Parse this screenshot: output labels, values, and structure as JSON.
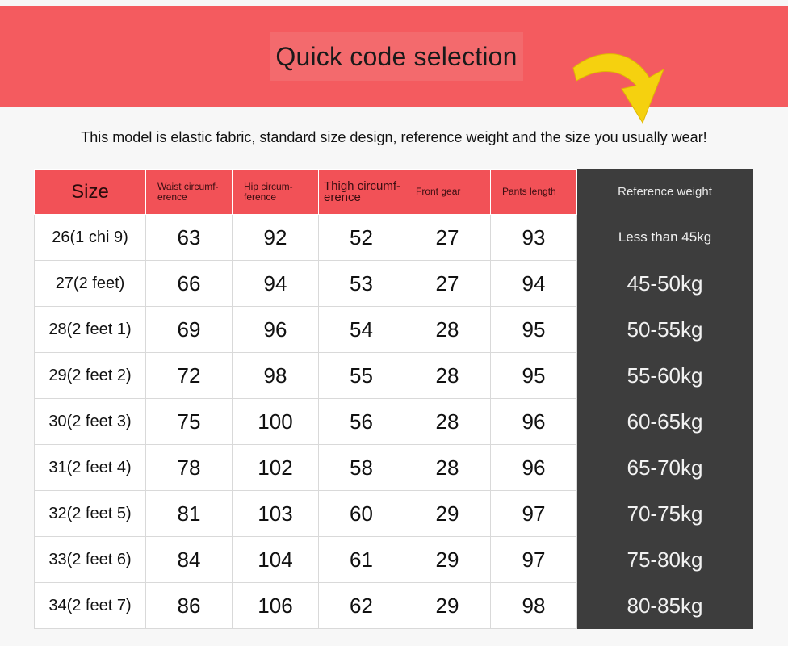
{
  "banner": {
    "title": "Quick code selection"
  },
  "subtitle": "This model is elastic fabric, standard size design, reference weight and the size you usually wear!",
  "table": {
    "headers": [
      "Size",
      "Waist circumf-erence",
      "Hip circum-ference",
      "Thigh circumf-erence",
      "Front gear",
      "Pants length",
      "Reference weight"
    ],
    "rows": [
      [
        "26(1 chi 9)",
        "63",
        "92",
        "52",
        "27",
        "93",
        "Less than 45kg"
      ],
      [
        "27(2 feet)",
        "66",
        "94",
        "53",
        "27",
        "94",
        "45-50kg"
      ],
      [
        "28(2 feet 1)",
        "69",
        "96",
        "54",
        "28",
        "95",
        "50-55kg"
      ],
      [
        "29(2 feet 2)",
        "72",
        "98",
        "55",
        "28",
        "95",
        "55-60kg"
      ],
      [
        "30(2 feet 3)",
        "75",
        "100",
        "56",
        "28",
        "96",
        "60-65kg"
      ],
      [
        "31(2 feet 4)",
        "78",
        "102",
        "58",
        "28",
        "96",
        "65-70kg"
      ],
      [
        "32(2 feet 5)",
        "81",
        "103",
        "60",
        "29",
        "97",
        "70-75kg"
      ],
      [
        "33(2 feet 6)",
        "84",
        "104",
        "61",
        "29",
        "97",
        "75-80kg"
      ],
      [
        "34(2 feet 7)",
        "86",
        "106",
        "62",
        "29",
        "98",
        "80-85kg"
      ]
    ]
  },
  "colors": {
    "banner": "#f45b5f",
    "header": "#f25157",
    "dark": "#3d3d3d",
    "arrow": "#f5d10f"
  },
  "icons": {
    "arrow": "curved-arrow-icon"
  }
}
